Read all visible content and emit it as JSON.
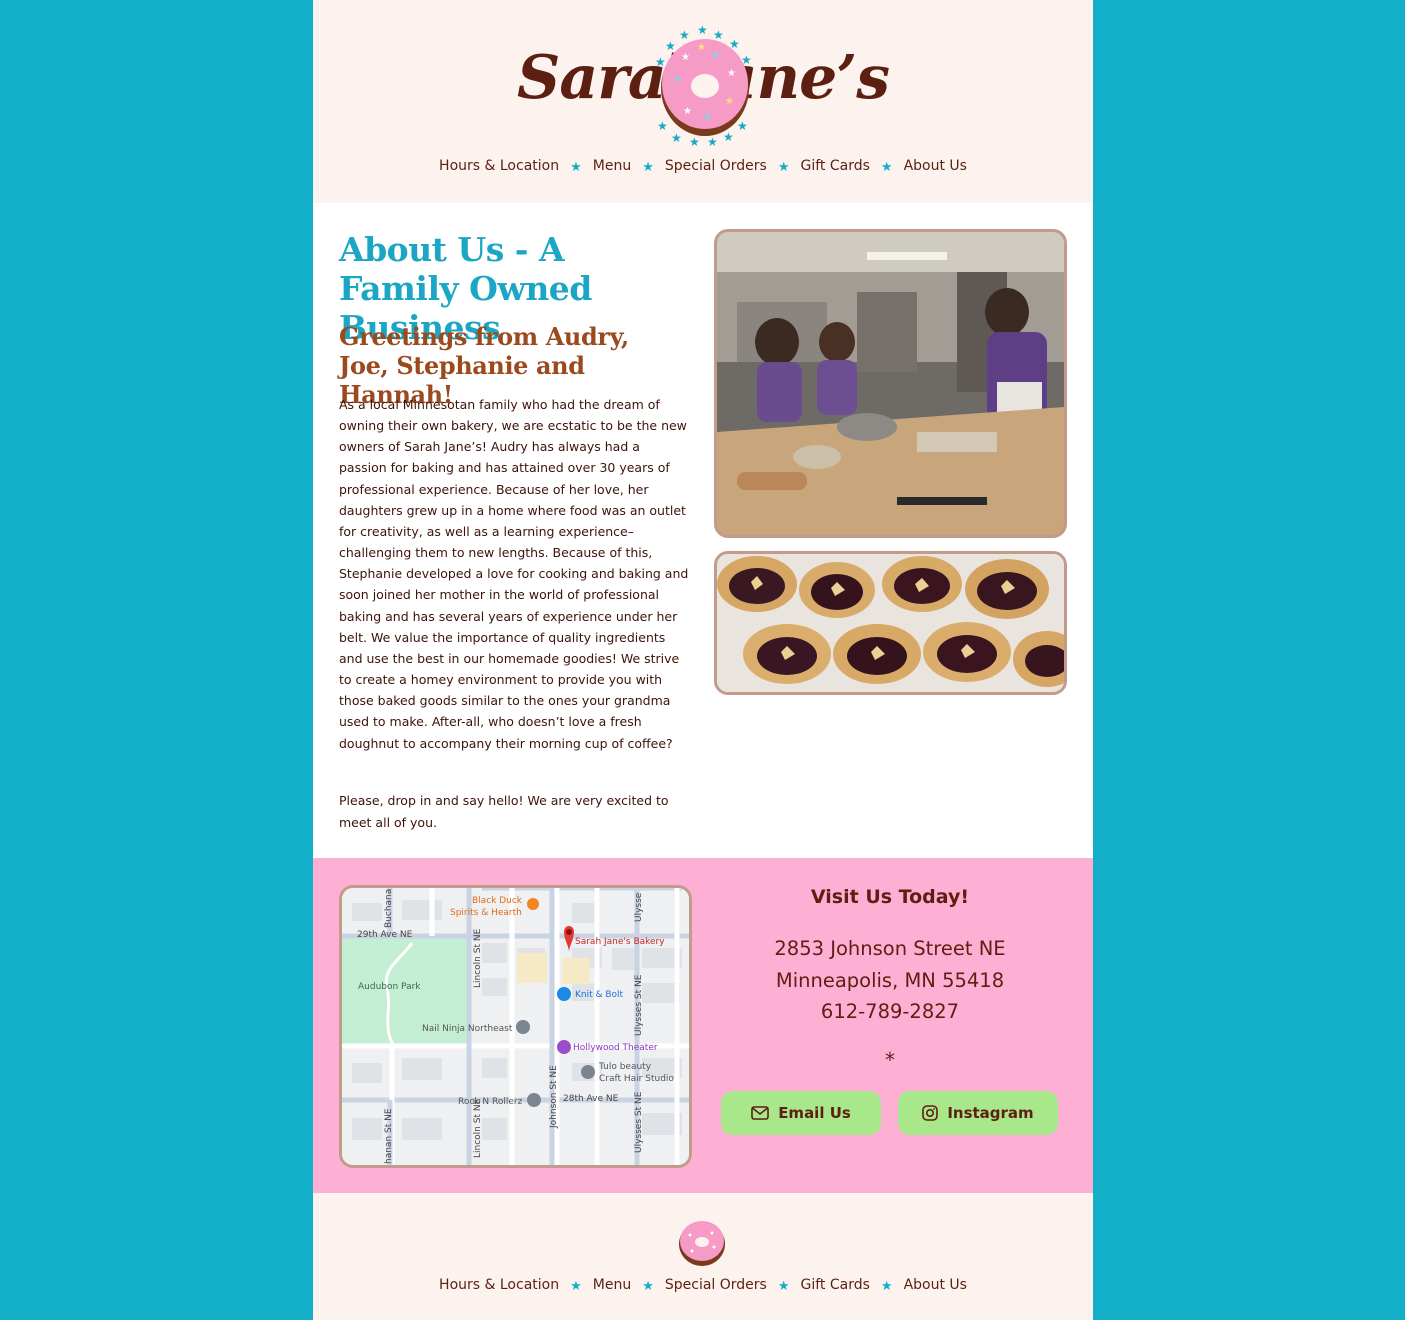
{
  "brand": {
    "logo_left": "Sarah",
    "logo_right": "Jane’s"
  },
  "nav": {
    "items": [
      "Hours & Location",
      "Menu",
      "Special Orders",
      "Gift Cards",
      "About Us"
    ],
    "separator_icon": "star-icon"
  },
  "about": {
    "title": "About Us - A Family Owned Business",
    "subtitle": "Greetings from Audry, Joe, Stephanie and Hannah!",
    "paragraph1": "As a local Minnesotan family who had the dream of owning their own bakery, we are ecstatic to be the new owners of Sarah Jane’s! Audry has always had a passion for baking and has attained over 30 years of professional experience. Because of her love, her daughters grew up in a home where food was an outlet for creativity, as well as a learning experience–challenging them to new lengths. Because of this, Stephanie developed a love for cooking and baking and soon joined her mother in the world of professional baking and has several years of experience under her belt. We value the importance of quality ingredients and use the best in our homemade goodies! We strive to create a homey environment to provide you with those baked goods similar to the ones your grandma used to make. After-all, who doesn’t love a fresh doughnut to accompany their morning cup of coffee?",
    "paragraph2": "Please, drop in and say hello! We are very excited to meet all of you."
  },
  "map": {
    "labels": {
      "black_duck": "Black Duck",
      "spirits": "Spirits & Hearth",
      "bakery": "Sarah Jane's Bakery",
      "knit": "Knit & Bolt",
      "hollywood": "Hollywood Theater",
      "tulo1": "Tulo beauty",
      "tulo2": "Craft Hair Studio",
      "nail": "Nail Ninja Northeast",
      "rock": "Rock N Rollerz",
      "audubon": "Audubon Park",
      "ave29": "29th Ave NE",
      "ave28": "28th Ave NE",
      "lincoln": "Lincoln St NE",
      "johnson": "Johnson St NE",
      "ulysses": "Ulysses St NE",
      "ulysses_top": "Ulysse",
      "buchanan_top": "Buchana",
      "buchanan_bottom": "hanan St NE"
    }
  },
  "visit": {
    "title": "Visit Us Today!",
    "address_line1": "2853 Johnson Street NE",
    "address_line2": "Minneapolis, MN 55418",
    "phone": "612-789-2827",
    "divider": "*",
    "email_label": "Email Us",
    "instagram_label": "Instagram"
  },
  "colors": {
    "background": "#13aec8",
    "cream": "#fcf3ee",
    "pink": "#fdb0d3",
    "brown": "#5c1f12",
    "teal_heading": "#1aa6c4",
    "rust_heading": "#9b4a1e",
    "button_green": "#a8e78a"
  }
}
